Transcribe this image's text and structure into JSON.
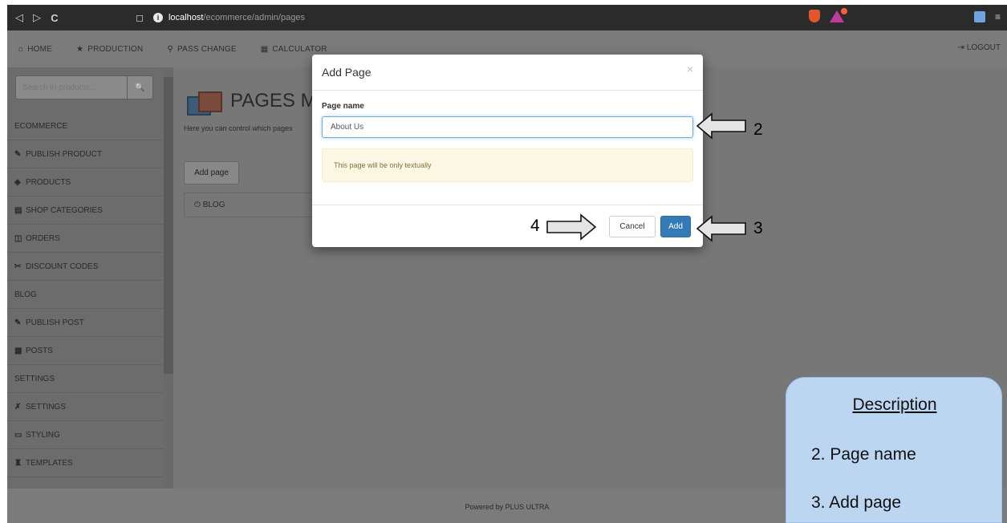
{
  "browser": {
    "nav_back": "◁",
    "nav_forward": "▷",
    "nav_reload": "C",
    "bookmark": "◻",
    "url_info": "i",
    "url_host": "localhost",
    "url_path": "/ecommerce/admin/pages",
    "menu_glyph": "≡"
  },
  "topnav": {
    "items": [
      {
        "glyph": "⌂",
        "label": "HOME"
      },
      {
        "glyph": "★",
        "label": "PRODUCTION"
      },
      {
        "glyph": "⚲",
        "label": "PASS CHANGE"
      },
      {
        "glyph": "▦",
        "label": "CALCULATOR"
      }
    ],
    "logout": "⇥  LOGOUT"
  },
  "sidebar": {
    "search_placeholder": "Search in products...",
    "search_icon": "🔍",
    "items": [
      {
        "type": "section",
        "label": "ECOMMERCE"
      },
      {
        "type": "item",
        "icon": "✎",
        "label": "PUBLISH PRODUCT"
      },
      {
        "type": "item",
        "icon": "◈",
        "label": "PRODUCTS"
      },
      {
        "type": "item",
        "icon": "▤",
        "label": "SHOP CATEGORIES"
      },
      {
        "type": "item",
        "icon": "◫",
        "label": "ORDERS"
      },
      {
        "type": "item",
        "icon": "✂",
        "label": "DISCOUNT CODES"
      },
      {
        "type": "section",
        "label": "BLOG"
      },
      {
        "type": "item",
        "icon": "✎",
        "label": "PUBLISH POST"
      },
      {
        "type": "item",
        "icon": "▦",
        "label": "POSTS"
      },
      {
        "type": "section",
        "label": "SETTINGS"
      },
      {
        "type": "item",
        "icon": "✗",
        "label": "SETTINGS"
      },
      {
        "type": "item",
        "icon": "▭",
        "label": "STYLING"
      },
      {
        "type": "item",
        "icon": "♜",
        "label": "TEMPLATES"
      }
    ]
  },
  "main": {
    "title": "PAGES M",
    "description": "Here you can control which pages",
    "add_page_button": "Add page",
    "blog_row": "⏻ BLOG"
  },
  "modal": {
    "title": "Add Page",
    "close": "×",
    "field_label": "Page name",
    "field_value": "About Us",
    "alert": "This page will be only textually",
    "cancel": "Cancel",
    "add": "Add"
  },
  "footer": {
    "text": "Powered by PLUS ULTRA"
  },
  "annotations": {
    "n2": "2",
    "n3": "3",
    "n4": "4"
  },
  "description": {
    "title": "Description",
    "lines": [
      "2. Page name",
      "3. Add page"
    ]
  }
}
